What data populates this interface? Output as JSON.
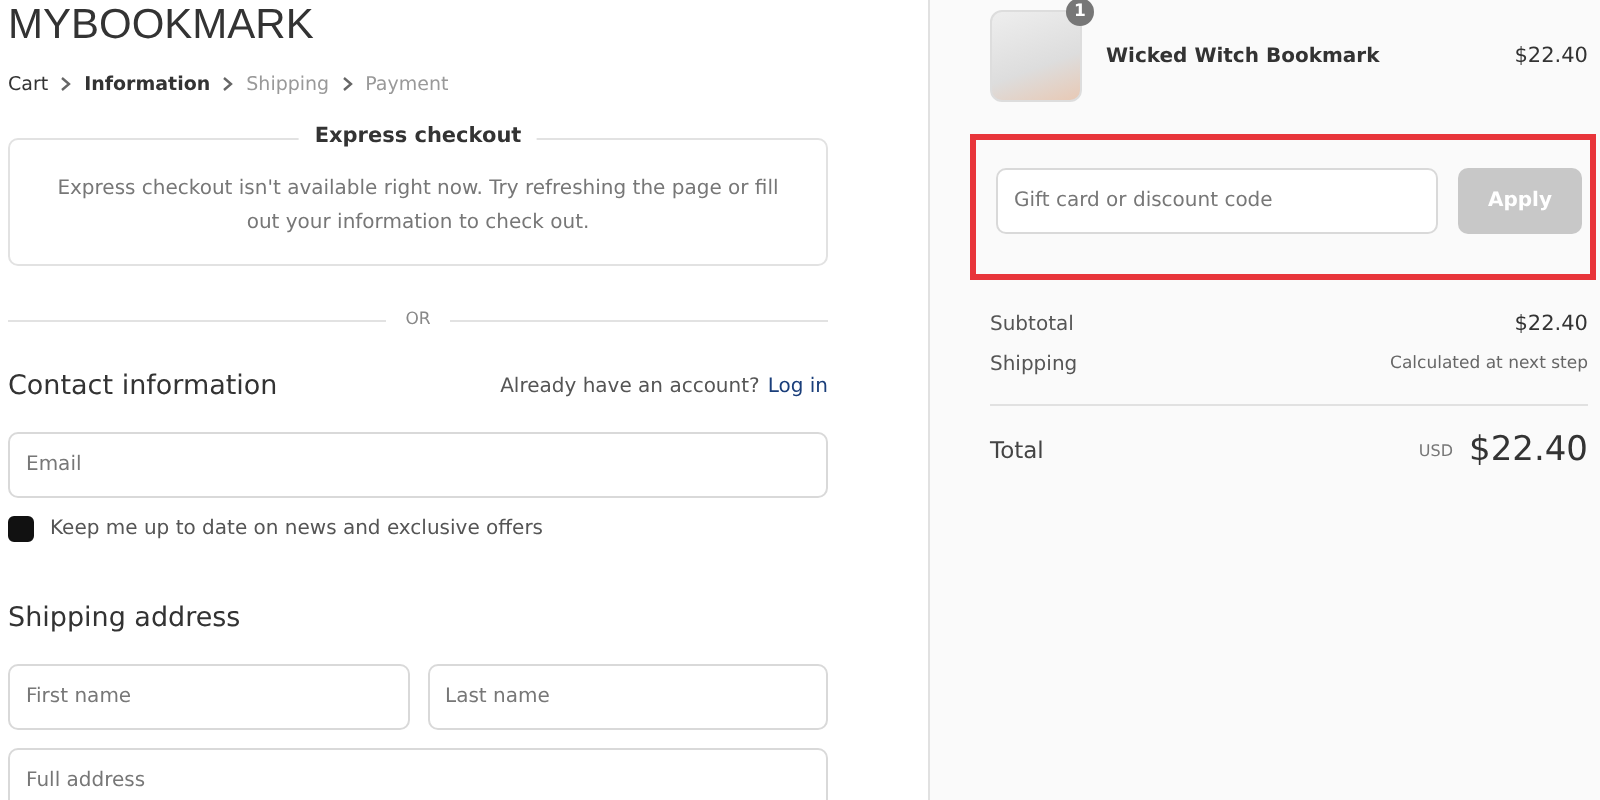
{
  "store": {
    "name": "MYBOOKMARK"
  },
  "breadcrumb": [
    {
      "label": "Cart",
      "visited": true,
      "selected": false
    },
    {
      "label": "Information",
      "visited": true,
      "selected": true
    },
    {
      "label": "Shipping",
      "visited": false,
      "selected": false
    },
    {
      "label": "Payment",
      "visited": false,
      "selected": false
    }
  ],
  "express_checkout": {
    "title": "Express checkout",
    "message": "Express checkout isn't available right now. Try refreshing the page or fill out your information to check out."
  },
  "divider_label": "OR",
  "contact": {
    "heading": "Contact information",
    "account_prompt": "Already have an account?",
    "login_link": "Log in",
    "email": {
      "placeholder": "Email"
    },
    "newsletter": {
      "label": "Keep me up to date on news and exclusive offers",
      "checked": true
    }
  },
  "shipping": {
    "heading": "Shipping address",
    "fields": [
      {
        "placeholder": "First name",
        "kind": "half"
      },
      {
        "placeholder": "Last name",
        "kind": "half"
      },
      {
        "placeholder": "Full address",
        "kind": "full"
      }
    ]
  },
  "summary": {
    "items": [
      {
        "name": "Wicked Witch Bookmark",
        "quantity": "1",
        "price": "$22.40"
      }
    ],
    "discount": {
      "placeholder": "Gift card or discount code",
      "button": "Apply",
      "disabled": true,
      "highlighted": true
    },
    "lines": [
      {
        "label": "Subtotal",
        "value": "$22.40",
        "kind": "amount"
      },
      {
        "label": "Shipping",
        "value": "Calculated at next step",
        "kind": "note"
      }
    ],
    "total": {
      "label": "Total",
      "currency": "USD",
      "value": "$22.40"
    }
  }
}
